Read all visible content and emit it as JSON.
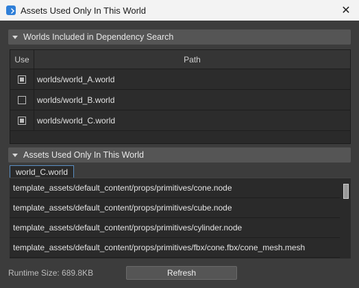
{
  "window": {
    "title": "Assets Used Only In This World",
    "close_glyph": "✕"
  },
  "section1": {
    "title": "Worlds Included in Dependency Search",
    "columns": {
      "use": "Use",
      "path": "Path"
    },
    "rows": [
      {
        "checked": true,
        "path": "worlds/world_A.world"
      },
      {
        "checked": false,
        "path": "worlds/world_B.world"
      },
      {
        "checked": true,
        "path": "worlds/world_C.world"
      }
    ]
  },
  "section2": {
    "title": "Assets Used Only In This World",
    "tab_label": "world_C.world",
    "assets": [
      "template_assets/default_content/props/primitives/cone.node",
      "template_assets/default_content/props/primitives/cube.node",
      "template_assets/default_content/props/primitives/cylinder.node",
      "template_assets/default_content/props/primitives/fbx/cone.fbx/cone_mesh.mesh"
    ]
  },
  "footer": {
    "runtime_size": "Runtime Size: 689.8KB",
    "refresh_label": "Refresh"
  },
  "icons": {
    "app": "app-icon",
    "close": "close-icon",
    "collapse": "triangle-down-icon"
  }
}
